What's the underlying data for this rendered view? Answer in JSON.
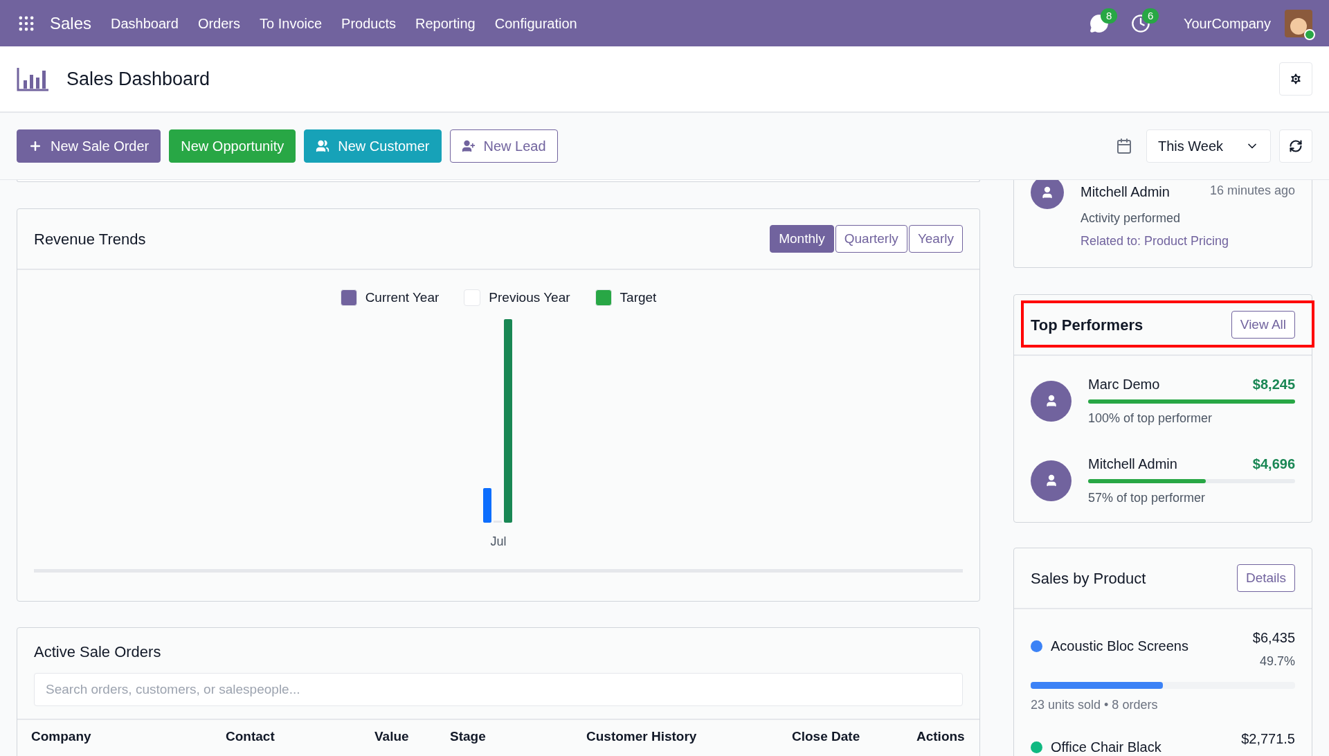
{
  "navbar": {
    "app_name": "Sales",
    "menu": [
      "Dashboard",
      "Orders",
      "To Invoice",
      "Products",
      "Reporting",
      "Configuration"
    ],
    "messages_count": "8",
    "activities_count": "6",
    "company": "YourCompany"
  },
  "header": {
    "title": "Sales Dashboard"
  },
  "toolbar": {
    "buttons": [
      {
        "label": "New Sale Order",
        "kind": "primary"
      },
      {
        "label": "New Opportunity",
        "kind": "success"
      },
      {
        "label": "New Customer",
        "kind": "info"
      },
      {
        "label": "New Lead",
        "kind": "outline"
      }
    ],
    "period": "This Week"
  },
  "revenue_trends": {
    "title": "Revenue Trends",
    "periods": [
      {
        "label": "Monthly",
        "selected": true
      },
      {
        "label": "Quarterly",
        "selected": false
      },
      {
        "label": "Yearly",
        "selected": false
      }
    ],
    "legend": [
      {
        "label": "Current Year",
        "color": "#71639e"
      },
      {
        "label": "Previous Year",
        "color": "#ffffff"
      },
      {
        "label": "Target",
        "color": "#28a745"
      }
    ],
    "x_label": "Jul"
  },
  "active_sale_orders": {
    "title": "Active Sale Orders",
    "search": {
      "placeholder": "Search orders, customers, or salespeople..."
    },
    "columns": [
      "Company",
      "Contact",
      "Value",
      "Stage",
      "Customer History",
      "Close Date",
      "Actions"
    ]
  },
  "activity": {
    "name": "Mitchell Admin",
    "time": "16 minutes ago",
    "text": "Activity performed",
    "related": "Related to: Product Pricing"
  },
  "top_performers": {
    "title": "Top Performers",
    "button": "View All",
    "highlighted": true,
    "people": [
      {
        "name": "Marc Demo",
        "amount": "$8,245",
        "level": 1,
        "caption": "100% of top performer"
      },
      {
        "name": "Mitchell Admin",
        "amount": "$4,696",
        "level": 0.57,
        "caption": "57% of top performer"
      }
    ]
  },
  "sales_by_product": {
    "title": "Sales by Product",
    "button": "Details",
    "products": [
      {
        "name": "Acoustic Bloc Screens",
        "color": "#3b82f6",
        "amount": "$6,435",
        "share": "49.7%",
        "level": 0.5,
        "meta": "23 units sold • 8 orders"
      },
      {
        "name": "Office Chair Black",
        "color": "#10b981",
        "amount": "$2,771.5"
      }
    ]
  }
}
